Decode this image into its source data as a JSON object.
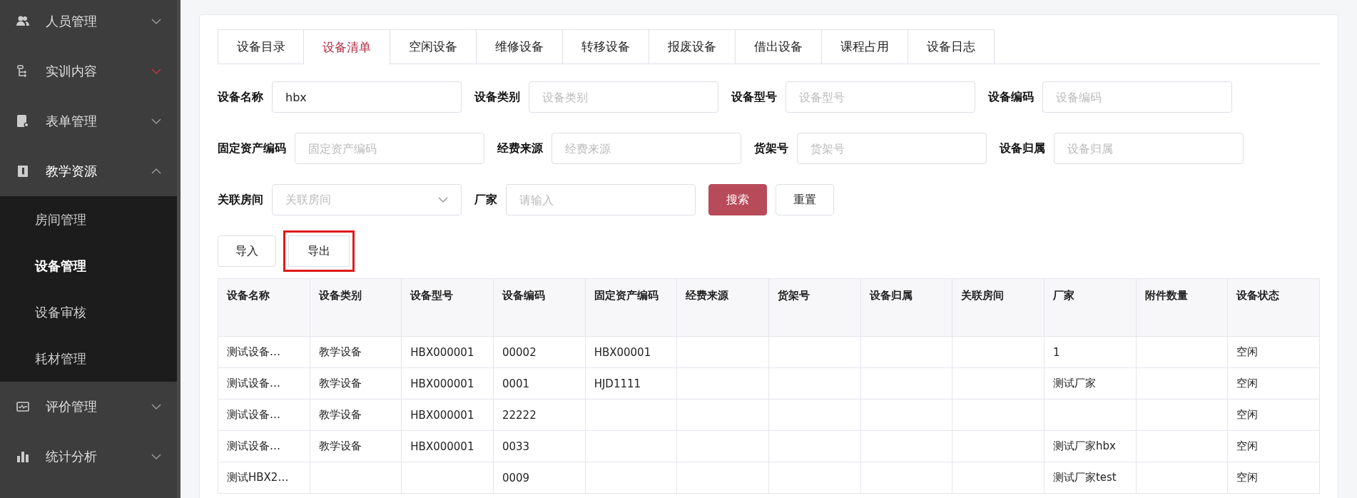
{
  "sidebar": {
    "items": [
      {
        "label": "人员管理",
        "expanded": false,
        "hovered": false
      },
      {
        "label": "实训内容",
        "expanded": false,
        "hovered": true
      },
      {
        "label": "表单管理",
        "expanded": false,
        "hovered": false
      },
      {
        "label": "教学资源",
        "expanded": true,
        "hovered": false,
        "children": [
          {
            "label": "房间管理",
            "selected": false
          },
          {
            "label": "设备管理",
            "selected": true
          },
          {
            "label": "设备审核",
            "selected": false
          },
          {
            "label": "耗材管理",
            "selected": false
          }
        ]
      },
      {
        "label": "评价管理",
        "expanded": false,
        "hovered": false
      },
      {
        "label": "统计分析",
        "expanded": false,
        "hovered": false
      }
    ]
  },
  "tabs": [
    {
      "label": "设备目录",
      "selected": false
    },
    {
      "label": "设备清单",
      "selected": true
    },
    {
      "label": "空闲设备",
      "selected": false
    },
    {
      "label": "维修设备",
      "selected": false
    },
    {
      "label": "转移设备",
      "selected": false
    },
    {
      "label": "报废设备",
      "selected": false
    },
    {
      "label": "借出设备",
      "selected": false
    },
    {
      "label": "课程占用",
      "selected": false
    },
    {
      "label": "设备日志",
      "selected": false
    }
  ],
  "filters": [
    [
      {
        "label": "设备名称",
        "kind": "input",
        "value": "hbx"
      },
      {
        "label": "设备类别",
        "kind": "input",
        "placeholder": "设备类别"
      },
      {
        "label": "设备型号",
        "kind": "input",
        "placeholder": "设备型号"
      },
      {
        "label": "设备编码",
        "kind": "input",
        "placeholder": "设备编码"
      }
    ],
    [
      {
        "label": "固定资产编码",
        "kind": "input",
        "placeholder": "固定资产编码"
      },
      {
        "label": "经费来源",
        "kind": "input",
        "placeholder": "经费来源"
      },
      {
        "label": "货架号",
        "kind": "input",
        "placeholder": "货架号"
      },
      {
        "label": "设备归属",
        "kind": "input",
        "placeholder": "设备归属"
      }
    ],
    [
      {
        "label": "关联房间",
        "kind": "select",
        "placeholder": "关联房间"
      },
      {
        "label": "厂家",
        "kind": "input",
        "placeholder": "请输入"
      }
    ]
  ],
  "search_button": "搜索",
  "reset_button": "重置",
  "actions": [
    {
      "label": "导入",
      "highlighted": false
    },
    {
      "label": "导出",
      "highlighted": true
    }
  ],
  "table": {
    "columns": [
      "设备名称",
      "设备类别",
      "设备型号",
      "设备编码",
      "固定资产编码",
      "经费来源",
      "货架号",
      "设备归属",
      "关联房间",
      "厂家",
      "附件数量",
      "设备状态"
    ],
    "rows": [
      [
        "测试设备…",
        "教学设备",
        "HBX000001",
        "00002",
        "HBX00001",
        "",
        "",
        "",
        "",
        "1",
        "",
        "空闲"
      ],
      [
        "测试设备…",
        "教学设备",
        "HBX000001",
        "0001",
        "HJD1111",
        "",
        "",
        "",
        "",
        "测试厂家",
        "",
        "空闲"
      ],
      [
        "测试设备…",
        "教学设备",
        "HBX000001",
        "22222",
        "",
        "",
        "",
        "",
        "",
        "",
        "",
        "空闲"
      ],
      [
        "测试设备…",
        "教学设备",
        "HBX000001",
        "0033",
        "",
        "",
        "",
        "",
        "",
        "测试厂家hbx",
        "",
        "空闲"
      ],
      [
        "测试HBX2…",
        "",
        "",
        "0009",
        "",
        "",
        "",
        "",
        "",
        "测试厂家test",
        "",
        "空闲"
      ]
    ]
  }
}
